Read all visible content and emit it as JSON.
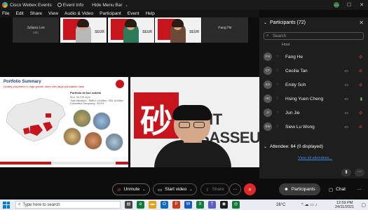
{
  "titlebar": {
    "app_name": "Cisco Webex Events",
    "event_info": "Event Info",
    "hide_menu": "Hide Menu Bar",
    "caret": "⌄",
    "minimize": "—",
    "maximize": "☐",
    "close": "✕"
  },
  "menu": [
    "File",
    "Edit",
    "Share",
    "View",
    "Audio & Video",
    "Participant",
    "Event",
    "Help"
  ],
  "thumbnails": [
    {
      "name": "Juliana Lee",
      "sub": "Info"
    },
    {
      "label": "SEUR"
    },
    {
      "label": "SEUR"
    },
    {
      "label": "SEUR"
    },
    {
      "name": "Fang He",
      "sub": ""
    }
  ],
  "slide": {
    "title": "Portfolio Summary",
    "subtitle": "Quality properties in high growth cities with large population base",
    "box_title": "Portfolio at four outlets",
    "box_lines": [
      "NLA : 61,278 sq m",
      "Total Valuation¹ : RMB 6.14 billion / S$1.16 billion",
      "Committed Occupancy : 93.9%"
    ]
  },
  "speaker": {
    "brush_char": "砂",
    "brand": "EIT SASSEUR"
  },
  "controls": {
    "unmute": "Unmute",
    "start_video": "Start video",
    "share": "Share",
    "more": "···",
    "end": "✕",
    "participants": "Participants",
    "chat": "Chat",
    "more_right": "···"
  },
  "panel": {
    "title": "Participants (72)",
    "search_placeholder": "Search",
    "host_label": "Host",
    "rows": [
      {
        "initials": "FH",
        "name": "Fang He",
        "cam": false
      },
      {
        "initials": "CT",
        "name": "Cecilia Tan",
        "cam": true
      },
      {
        "initials": "ES",
        "name": "Emily Soh",
        "cam": true
      },
      {
        "initials": "HC",
        "name": "Hsing Yuen Cheng",
        "cam": true
      },
      {
        "initials": "JJ",
        "name": "Jun Jie",
        "cam": true
      },
      {
        "initials": "SW",
        "name": "Siew Lu Wong",
        "cam": true
      }
    ],
    "attendee": "Attendee: 64 (0 displayed)",
    "view_all": "View all attendees..."
  },
  "taskbar": {
    "search": "Type here to search",
    "weather": "26°C",
    "time": "12:59 PM",
    "date": "24/11/2021",
    "notif": "▢"
  },
  "colors": {
    "accent_red": "#c8141d",
    "muted_red": "#e34850",
    "link_blue": "#3b8eea"
  }
}
